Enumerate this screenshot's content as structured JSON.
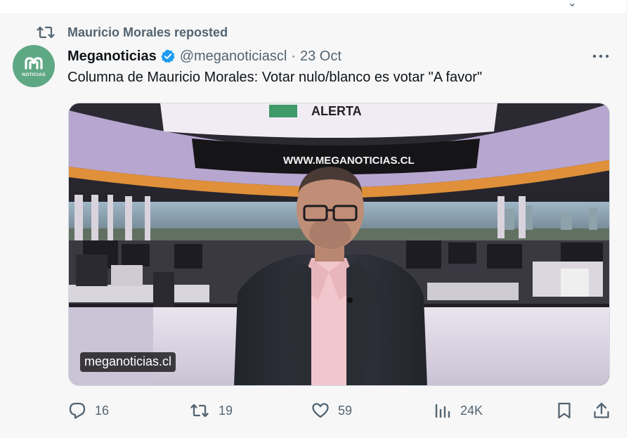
{
  "repost": {
    "text": "Mauricio Morales reposted"
  },
  "author": {
    "avatar_text": "NOTICIAS",
    "name": "Meganoticias",
    "handle": "@meganoticiascl",
    "separator": "·",
    "date": "23 Oct",
    "verified": true
  },
  "tweet": {
    "text": "Columna de Mauricio Morales: Votar nulo/blanco es votar \"A favor\""
  },
  "media": {
    "source_label": "meganoticias.cl",
    "studio_sign": "WWW.MEGANOTICIAS.CL",
    "banner_text": "ALERTA"
  },
  "actions": {
    "replies": "16",
    "reposts": "19",
    "likes": "59",
    "views": "24K"
  },
  "icons": {
    "repost": "repost-icon",
    "verified": "verified-badge-icon",
    "more": "more-icon",
    "reply": "reply-icon",
    "like": "heart-icon",
    "views": "analytics-icon",
    "bookmark": "bookmark-icon",
    "share": "share-icon"
  },
  "colors": {
    "verified": "#1d9bf0",
    "muted": "#536471",
    "avatar_bg": "#5fa884",
    "background": "#f7f7f7"
  }
}
